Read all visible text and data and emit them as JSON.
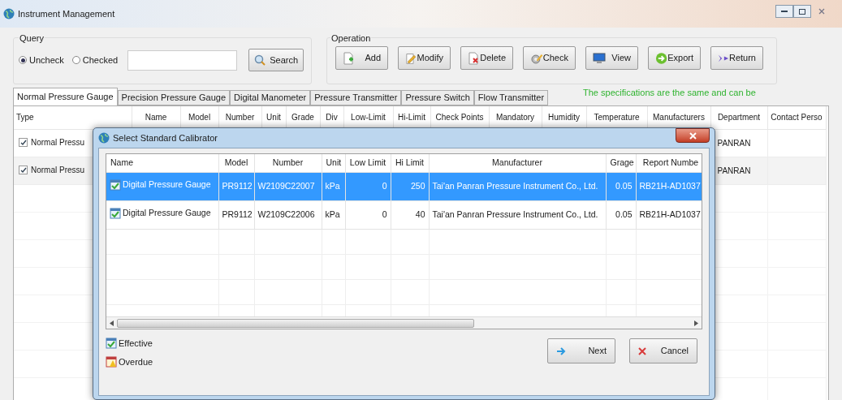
{
  "window": {
    "title": "Instrument Management"
  },
  "query": {
    "label": "Query",
    "options": [
      {
        "label": "Uncheck",
        "selected": true
      },
      {
        "label": "Checked",
        "selected": false
      }
    ],
    "search_button": "Search"
  },
  "operation": {
    "label": "Operation",
    "buttons": [
      "Add",
      "Modify",
      "Delete",
      "Check",
      "View",
      "Export",
      "Return"
    ]
  },
  "tabs": [
    {
      "label": "Normal Pressure Gauge",
      "selected": true
    },
    {
      "label": "Precision Pressure Gauge",
      "selected": false
    },
    {
      "label": "Digital Manometer",
      "selected": false
    },
    {
      "label": "Pressure Transmitter",
      "selected": false
    },
    {
      "label": "Pressure Switch",
      "selected": false
    },
    {
      "label": "Flow Transmitter",
      "selected": false
    }
  ],
  "note": "The specifications are the same and can be",
  "table": {
    "columns": [
      "Type",
      "Name",
      "Model",
      "Number",
      "Unit",
      "Grade",
      "Div",
      "Low-Limit",
      "Hi-Limit",
      "Check Points",
      "Mandatory",
      "Humidity",
      "Temperature",
      "Manufacturers",
      "Department",
      "Contact Perso"
    ],
    "rows": [
      {
        "checked": true,
        "type": "Normal Pressu",
        "department": "PANRAN"
      },
      {
        "checked": true,
        "type": "Normal Pressu",
        "department": "PANRAN"
      }
    ]
  },
  "dialog": {
    "title": "Select Standard Calibrator",
    "columns": [
      "Name",
      "Model",
      "Number",
      "Unit",
      "Low Limit",
      "Hi Limit",
      "Manufacturer",
      "Grage",
      "Report Numbe"
    ],
    "rows": [
      {
        "selected": true,
        "kind": "effective",
        "cells": [
          "Digital Pressure Gauge",
          "PR9112",
          "W2109C22007",
          "kPa",
          "0",
          "250",
          "Tai'an Panran Pressure Instrument Co., Ltd.",
          "0.05",
          "RB21H-AD1037"
        ]
      },
      {
        "selected": false,
        "kind": "effective",
        "cells": [
          "Digital Pressure Gauge",
          "PR9112",
          "W2109C22006",
          "kPa",
          "0",
          "40",
          "Tai'an Panran Pressure Instrument Co., Ltd.",
          "0.05",
          "RB21H-AD1037"
        ]
      }
    ],
    "legend": [
      {
        "kind": "effective",
        "label": "Effective"
      },
      {
        "kind": "overdue",
        "label": "Overdue"
      }
    ],
    "buttons": [
      {
        "kind": "next",
        "label": "Next"
      },
      {
        "kind": "cancel",
        "label": "Cancel"
      }
    ]
  }
}
